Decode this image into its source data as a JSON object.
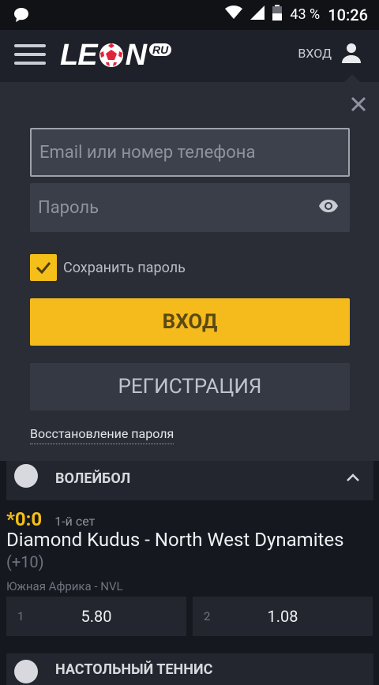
{
  "status_bar": {
    "battery": "43 %",
    "time": "10:26"
  },
  "header": {
    "logo": "LEON",
    "logo_badge": "RU",
    "login_label": "ВХОД"
  },
  "login_form": {
    "email_placeholder": "Email или номер телефона",
    "password_placeholder": "Пароль",
    "remember_label": "Сохранить пароль",
    "login_button": "ВХОД",
    "register_button": "РЕГИСТРАЦИЯ",
    "recover_link": "Восстановление пароля"
  },
  "events": {
    "sport1": "ВОЛЕЙБОЛ",
    "score": "*0:0",
    "set": "1-й сет",
    "match": "Diamond Kudus - North West Dynamites",
    "extra": "(+10)",
    "league": "Южная Африка - NVL",
    "odds": [
      {
        "num": "1",
        "value": "5.80"
      },
      {
        "num": "2",
        "value": "1.08"
      }
    ],
    "sport2": "НАСТОЛЬНЫЙ ТЕННИС"
  },
  "colors": {
    "accent": "#f5bb1d",
    "panel": "#2a2d36",
    "background": "#16181f"
  }
}
